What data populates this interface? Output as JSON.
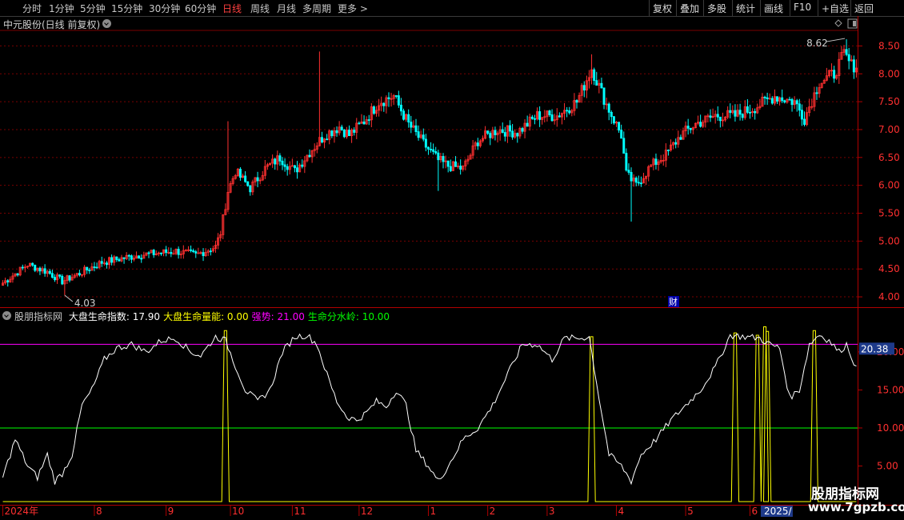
{
  "toolbar": {
    "periods": [
      "分时",
      "1分钟",
      "5分钟",
      "15分钟",
      "30分钟",
      "60分钟",
      "日线",
      "周线",
      "月线",
      "多周期",
      "更多 >"
    ],
    "active_period": "日线",
    "tools": [
      "复权",
      "叠加",
      "多股",
      "统计",
      "画线",
      "F10",
      "+自选",
      "返回"
    ]
  },
  "stock_title": "中元股份(日线 前复权)",
  "colors": {
    "up": "#ff3030",
    "down": "#00ffff",
    "indicator": "#ffffff",
    "energy": "#ffff00",
    "strong": "#ff00ff",
    "watershed": "#00ff00",
    "grid": "#7a0000"
  },
  "indicator": {
    "name": "股朋指标网",
    "items": [
      {
        "label": "大盘生命指数",
        "value": "17.90",
        "color": "#ffffff"
      },
      {
        "label": "大盘生命量能",
        "value": "0.00",
        "color": "#ffff00"
      },
      {
        "label": "强势",
        "value": "21.00",
        "color": "#ff00ff"
      },
      {
        "label": "生命分水岭",
        "value": "10.00",
        "color": "#00ff00"
      }
    ],
    "current_value_tag": "20.38"
  },
  "annotations": {
    "high_label": "8.62",
    "low_label": "4.03",
    "finance_marker": "财"
  },
  "watermark": {
    "title": "股朋指标网",
    "url": "www.7gpzb.com"
  },
  "chart_data": [
    {
      "type": "candlestick",
      "ylim": [
        3.8,
        8.75
      ],
      "y_ticks": [
        "8.50",
        "8.00",
        "7.50",
        "7.00",
        "6.50",
        "6.00",
        "5.50",
        "5.00",
        "4.50",
        "4.00"
      ],
      "anchors": [
        [
          0,
          4.25
        ],
        [
          10,
          4.58
        ],
        [
          18,
          4.45
        ],
        [
          24,
          4.28
        ],
        [
          30,
          4.4
        ],
        [
          40,
          4.62
        ],
        [
          55,
          4.75
        ],
        [
          70,
          4.82
        ],
        [
          78,
          4.75
        ],
        [
          86,
          4.9
        ],
        [
          88,
          5.15
        ],
        [
          91,
          5.9
        ],
        [
          94,
          6.25
        ],
        [
          100,
          5.95
        ],
        [
          106,
          6.3
        ],
        [
          112,
          6.5
        ],
        [
          118,
          6.25
        ],
        [
          124,
          6.6
        ],
        [
          130,
          6.9
        ],
        [
          136,
          7.05
        ],
        [
          140,
          6.9
        ],
        [
          146,
          7.15
        ],
        [
          152,
          7.5
        ],
        [
          158,
          7.6
        ],
        [
          164,
          7.1
        ],
        [
          170,
          6.75
        ],
        [
          176,
          6.45
        ],
        [
          180,
          6.35
        ],
        [
          186,
          6.3
        ],
        [
          192,
          6.8
        ],
        [
          200,
          7.0
        ],
        [
          208,
          6.95
        ],
        [
          216,
          7.25
        ],
        [
          224,
          7.25
        ],
        [
          232,
          7.5
        ],
        [
          238,
          8.1
        ],
        [
          244,
          7.45
        ],
        [
          250,
          6.9
        ],
        [
          252,
          6.2
        ],
        [
          256,
          6.0
        ],
        [
          262,
          6.35
        ],
        [
          268,
          6.55
        ],
        [
          274,
          6.9
        ],
        [
          280,
          7.1
        ],
        [
          288,
          7.25
        ],
        [
          296,
          7.25
        ],
        [
          304,
          7.4
        ],
        [
          312,
          7.6
        ],
        [
          320,
          7.5
        ],
        [
          324,
          7.2
        ],
        [
          330,
          7.85
        ],
        [
          336,
          8.0
        ],
        [
          340,
          8.35
        ],
        [
          343,
          8.15
        ]
      ],
      "spikes": [
        {
          "i": 128,
          "high": 8.4
        },
        {
          "i": 91,
          "high": 7.15
        },
        {
          "i": 238,
          "high": 8.35
        },
        {
          "i": 254,
          "low": 5.35
        },
        {
          "i": 341,
          "high": 8.62
        },
        {
          "i": 25,
          "low": 4.03
        },
        {
          "i": 176,
          "low": 5.9
        }
      ]
    },
    {
      "type": "line",
      "ylim": [
        0,
        24.2
      ],
      "y_ticks": [
        "20.00",
        "15.00",
        "10.00",
        "5.00"
      ],
      "series": [
        {
          "name": "大盘生命指数",
          "color": "#ffffff",
          "anchors": [
            [
              0,
              3.5
            ],
            [
              5,
              8.5
            ],
            [
              10,
              5
            ],
            [
              14,
              3.5
            ],
            [
              18,
              6.5
            ],
            [
              21,
              3
            ],
            [
              24,
              4
            ],
            [
              28,
              6.5
            ],
            [
              32,
              13
            ],
            [
              36,
              15
            ],
            [
              41,
              19
            ],
            [
              46,
              20.5
            ],
            [
              52,
              21
            ],
            [
              58,
              20
            ],
            [
              64,
              21.5
            ],
            [
              70,
              21.8
            ],
            [
              76,
              20
            ],
            [
              80,
              19.5
            ],
            [
              86,
              22
            ],
            [
              90,
              21.5
            ],
            [
              93,
              19
            ],
            [
              98,
              15
            ],
            [
              103,
              13.5
            ],
            [
              108,
              15
            ],
            [
              113,
              20
            ],
            [
              118,
              22
            ],
            [
              123,
              22.2
            ],
            [
              127,
              21
            ],
            [
              131,
              17
            ],
            [
              135,
              13.5
            ],
            [
              139,
              11.5
            ],
            [
              143,
              11
            ],
            [
              147,
              12
            ],
            [
              151,
              13.5
            ],
            [
              155,
              12.8
            ],
            [
              159,
              15
            ],
            [
              163,
              13
            ],
            [
              167,
              7
            ],
            [
              172,
              5
            ],
            [
              176,
              3
            ],
            [
              180,
              5
            ],
            [
              186,
              8.5
            ],
            [
              192,
              10
            ],
            [
              198,
              13
            ],
            [
              204,
              17
            ],
            [
              210,
              21
            ],
            [
              216,
              21
            ],
            [
              222,
              19
            ],
            [
              227,
              21.8
            ],
            [
              233,
              21.8
            ],
            [
              237,
              22
            ],
            [
              241,
              14
            ],
            [
              245,
              6.5
            ],
            [
              250,
              5
            ],
            [
              254,
              3
            ],
            [
              258,
              6.5
            ],
            [
              264,
              8.5
            ],
            [
              270,
              11
            ],
            [
              276,
              13
            ],
            [
              282,
              15
            ],
            [
              288,
              18
            ],
            [
              294,
              22.2
            ],
            [
              300,
              22
            ],
            [
              306,
              21.8
            ],
            [
              310,
              21
            ],
            [
              314,
              20.5
            ],
            [
              318,
              14
            ],
            [
              322,
              15
            ],
            [
              326,
              21
            ],
            [
              330,
              22.3
            ],
            [
              334,
              21.5
            ],
            [
              338,
              20
            ],
            [
              341,
              21
            ],
            [
              345,
              17.9
            ]
          ]
        },
        {
          "name": "大盘生命量能",
          "color": "#ffff00",
          "pulses": [
            [
              90,
              22.8
            ],
            [
              238,
              22
            ],
            [
              296,
              22.5
            ],
            [
              305,
              22.2
            ],
            [
              308,
              23.3
            ],
            [
              309,
              22.7
            ],
            [
              328,
              22.8
            ]
          ]
        },
        {
          "name": "强势",
          "color": "#ff00ff",
          "y": 21
        },
        {
          "name": "生命分水岭",
          "color": "#00ff00",
          "y": 10
        }
      ]
    }
  ],
  "x_axis": {
    "labels": [
      {
        "i": 0,
        "label": "2024年",
        "color": "#ff3030"
      },
      {
        "i": 37,
        "label": "8",
        "color": "#ff3030"
      },
      {
        "i": 66,
        "label": "9",
        "color": "#ff3030"
      },
      {
        "i": 92,
        "label": "10",
        "color": "#ff3030"
      },
      {
        "i": 117,
        "label": "11",
        "color": "#ff3030"
      },
      {
        "i": 144,
        "label": "12",
        "color": "#ff3030"
      },
      {
        "i": 172,
        "label": "1",
        "color": "#ff3030"
      },
      {
        "i": 196,
        "label": "2",
        "color": "#ff3030"
      },
      {
        "i": 220,
        "label": "3",
        "color": "#ff3030"
      },
      {
        "i": 248,
        "label": "4",
        "color": "#ff3030"
      },
      {
        "i": 276,
        "label": "5",
        "color": "#ff3030"
      },
      {
        "i": 302,
        "label": "6",
        "color": "#ff3030"
      },
      {
        "i": 307,
        "label": "2025/",
        "color": "#ffffff",
        "highlight": true
      }
    ],
    "count": 346
  }
}
